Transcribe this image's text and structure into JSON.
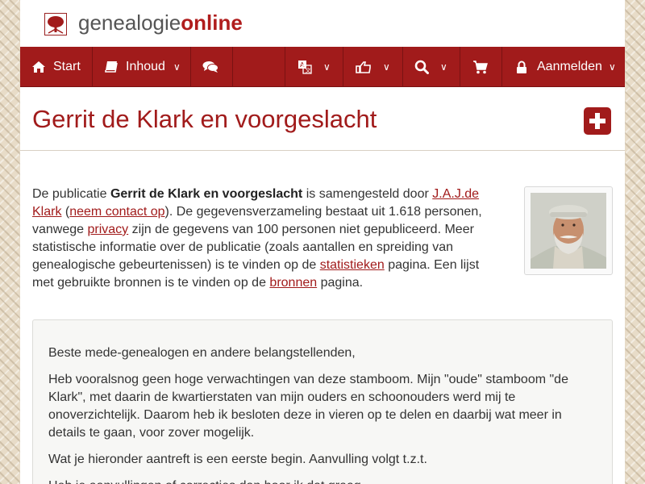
{
  "logo": {
    "part1": "genealogie",
    "part2": "online"
  },
  "nav": {
    "start": "Start",
    "inhoud": "Inhoud",
    "aanmelden": "Aanmelden"
  },
  "title": "Gerrit de Klark en voorgeslacht",
  "intro": {
    "t1": "De publicatie ",
    "pubname": "Gerrit de Klark en voorgeslacht",
    "t2": " is samengesteld door ",
    "author": "J.A.J.de Klark",
    "t3": " (",
    "contact": "neem contact op",
    "t4": "). De gegevensverzameling bestaat uit 1.618 personen, vanwege ",
    "privacy": "privacy",
    "t5": " zijn de gegevens van 100 personen niet gepubliceerd. Meer statistische informatie over de publicatie (zoals aantallen en spreiding van genealogische gebeurtenissen) is te vinden op de ",
    "stats": "statistieken",
    "t6": " pagina. Een lijst met gebruikte bronnen is te vinden op de ",
    "sources": "bronnen",
    "t7": " pagina."
  },
  "notice": {
    "p1": "Beste mede-genealogen en andere belangstellenden,",
    "p2": "Heb vooralsnog geen hoge verwachtingen van deze stamboom. Mijn \"oude\" stamboom \"de Klark\", met daarin de kwartierstaten van mijn ouders en schoonouders werd mij te onoverzichtelijk. Daarom heb ik besloten deze in vieren op te delen en daarbij wat meer in details te gaan, voor zover mogelijk.",
    "p3": "Wat je hieronder aantreft is een eerste begin. Aanvulling volgt t.z.t.",
    "p4": "Heb je aanvullingen of correcties dan hoor ik dat graag."
  },
  "icons": {
    "home": "home-icon",
    "book": "book-icon",
    "comments": "comments-icon",
    "language": "language-icon",
    "thumbs": "thumbs-up-icon",
    "search": "search-icon",
    "cart": "cart-icon",
    "lock": "lock-icon",
    "plus": "plus-square-icon"
  },
  "colors": {
    "brand": "#a11b1b",
    "text": "#333333",
    "logo_grey": "#555555"
  }
}
